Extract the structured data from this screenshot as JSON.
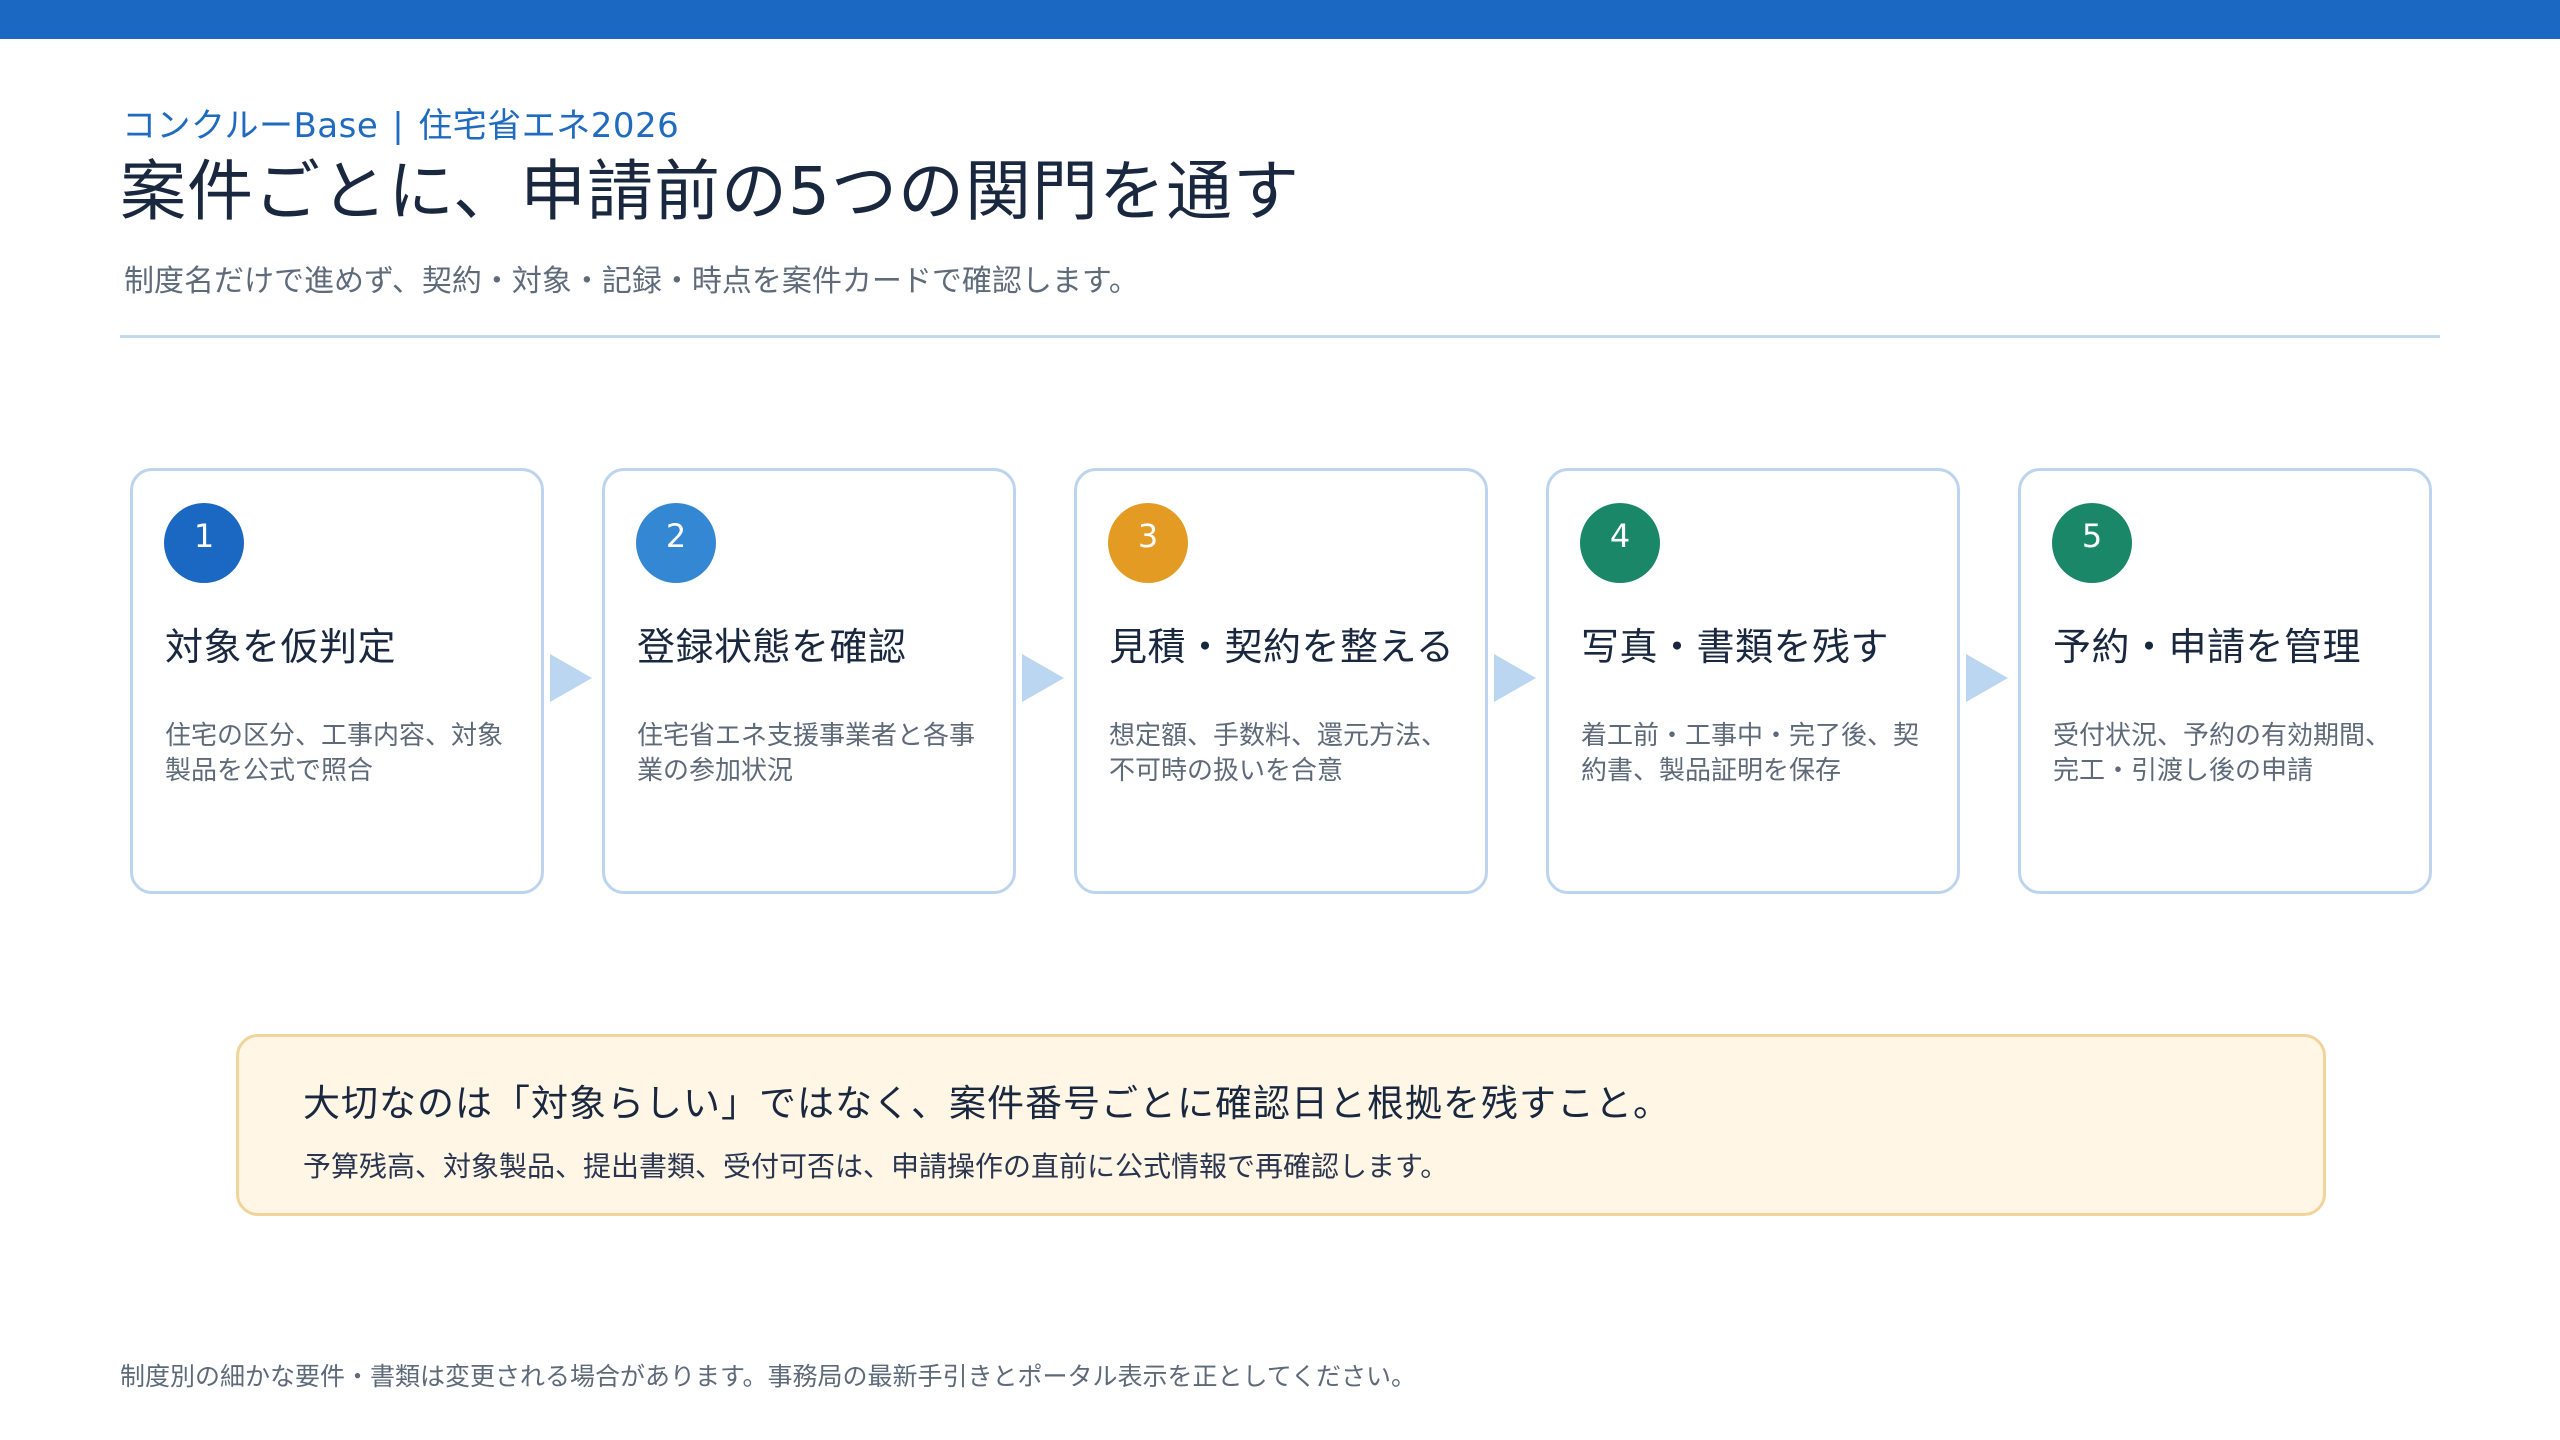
{
  "header": {
    "brand": "コンクルーBase",
    "separator": "|",
    "program": "住宅省エネ2026",
    "title": "案件ごとに、申請前の5つの関門を通す",
    "subtitle": "制度名だけで進めず、契約・対象・記録・時点を案件カードで確認します。"
  },
  "steps": [
    {
      "number": "1",
      "title": "対象を仮判定",
      "desc": "住宅の区分、工事内容、対象製品を公式で照合",
      "color": "#1a68c2"
    },
    {
      "number": "2",
      "title": "登録状態を確認",
      "desc": "住宅省エネ支援事業者と各事業の参加状況",
      "color": "#3487d2"
    },
    {
      "number": "3",
      "title": "見積・契約を整える",
      "desc": "想定額、手数料、還元方法、不可時の扱いを合意",
      "color": "#e39b24"
    },
    {
      "number": "4",
      "title": "写真・書類を残す",
      "desc": "着工前・工事中・完了後、契約書、製品証明を保存",
      "color": "#1b8769"
    },
    {
      "number": "5",
      "title": "予約・申請を管理",
      "desc": "受付状況、予約の有効期間、完工・引渡し後の申請",
      "color": "#1b8769"
    }
  ],
  "arrow_color": "#bad6f1",
  "callout": {
    "title": "大切なのは「対象らしい」ではなく、案件番号ごとに確認日と根拠を残すこと。",
    "body": "予算残高、対象製品、提出書類、受付可否は、申請操作の直前に公式情報で再確認します。"
  },
  "footnote": "制度別の細かな要件・書類は変更される場合があります。事務局の最新手引きとポータル表示を正としてください。"
}
